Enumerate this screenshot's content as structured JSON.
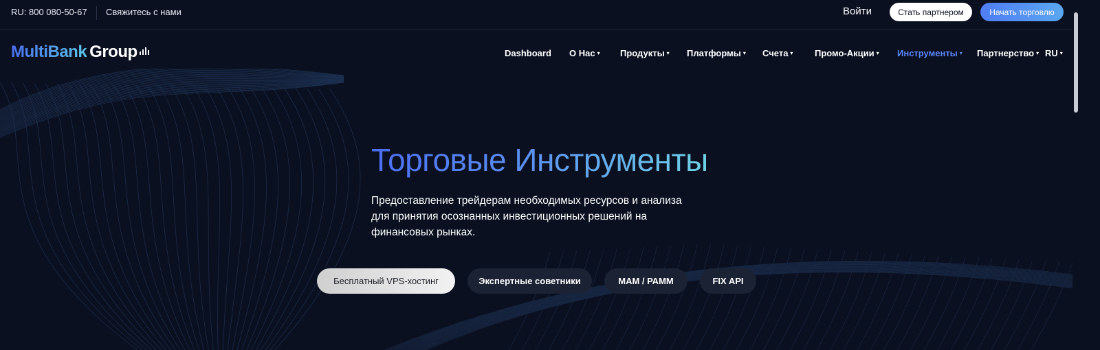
{
  "topbar": {
    "phone": "RU: 800 080-50-67",
    "contact": "Свяжитесь с нами",
    "login": "Войти",
    "partner_button": "Стать партнером",
    "trade_button": "Начать торговлю"
  },
  "logo": {
    "multibank": "MultiBank",
    "group": "Group"
  },
  "nav": {
    "items": [
      {
        "label": "Dashboard",
        "dropdown": false
      },
      {
        "label": "О Нас",
        "dropdown": true
      },
      {
        "label": "Продукты",
        "dropdown": true
      },
      {
        "label": "Платформы",
        "dropdown": true
      },
      {
        "label": "Счета",
        "dropdown": true
      },
      {
        "label": "Промо-Акции",
        "dropdown": true
      },
      {
        "label": "Инструменты",
        "dropdown": true,
        "active": true
      },
      {
        "label": "Партнерство",
        "dropdown": true
      },
      {
        "label": "RU",
        "dropdown": true
      }
    ],
    "caret": "▾"
  },
  "hero": {
    "title": "Торговые Инструменты",
    "subtitle": "Предоставление трейдерам необходимых ресурсов и анализа для принятия осознанных инвестиционных решений на финансовых рынках."
  },
  "chips": [
    {
      "label": "Бесплатный VPS-хостинг",
      "active": true
    },
    {
      "label": "Экспертные советники",
      "active": false
    },
    {
      "label": "МАМ / РАММ",
      "active": false
    },
    {
      "label": "FIX API",
      "active": false
    }
  ],
  "colors": {
    "background": "#0b1020",
    "accent": "#5b87ff",
    "chip_bg": "#1b2233"
  }
}
